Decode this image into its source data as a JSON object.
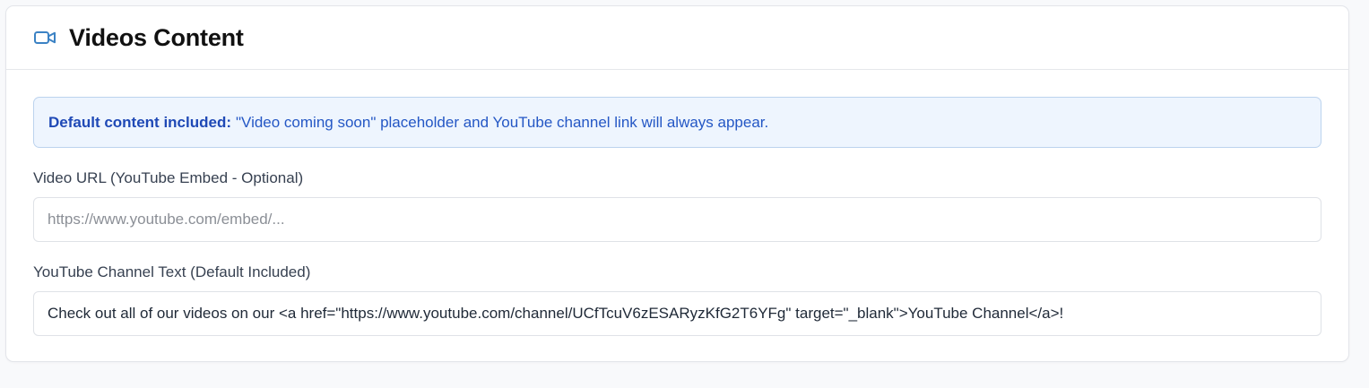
{
  "section": {
    "icon": "video-camera-icon",
    "title": "Videos Content"
  },
  "notice": {
    "strong_text": "Default content included:",
    "body_text": "\"Video coming soon\" placeholder and YouTube channel link will always appear."
  },
  "video_url_field": {
    "label": "Video URL (YouTube Embed - Optional)",
    "value": "",
    "placeholder": "https://www.youtube.com/embed/..."
  },
  "channel_text_field": {
    "label": "YouTube Channel Text (Default Included)",
    "value": "Check out all of our videos on our <a href=\"https://www.youtube.com/channel/UCfTcuV6zESARyzKfG2T6YFg\" target=\"_blank\">YouTube Channel</a>!",
    "placeholder": ""
  },
  "colors": {
    "accent": "#3b82c4",
    "notice_background": "#eef5fe",
    "notice_text": "#2457c5"
  }
}
